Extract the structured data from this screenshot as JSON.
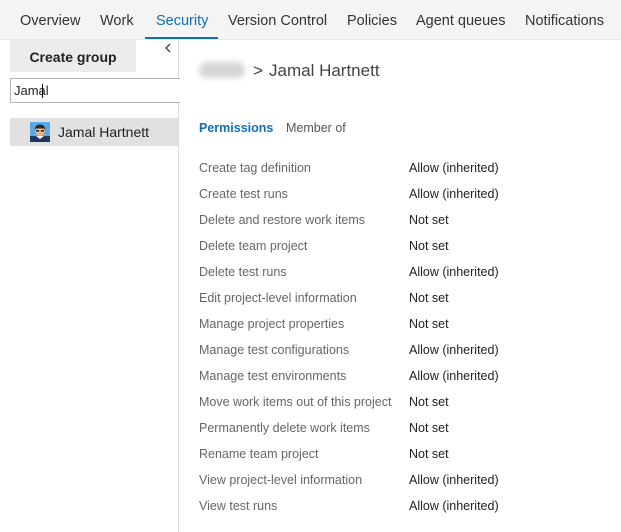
{
  "nav": {
    "tabs": [
      {
        "label": "Overview"
      },
      {
        "label": "Work"
      },
      {
        "label": "Security"
      },
      {
        "label": "Version Control"
      },
      {
        "label": "Policies"
      },
      {
        "label": "Agent queues"
      },
      {
        "label": "Notifications"
      }
    ],
    "active_tab": "Security"
  },
  "sidebar": {
    "create_group_label": "Create group",
    "collapse_icon": "chevron-left-icon",
    "search_value": "Jamal",
    "results": [
      {
        "name": "Jamal Hartnett",
        "icon": "user-avatar-icon"
      }
    ]
  },
  "breadcrumb": {
    "separator": ">",
    "current": "Jamal Hartnett"
  },
  "subtabs": {
    "permissions": "Permissions",
    "member_of": "Member of",
    "active": "Permissions"
  },
  "permissions": [
    {
      "name": "Create tag definition",
      "value": "Allow (inherited)"
    },
    {
      "name": "Create test runs",
      "value": "Allow (inherited)"
    },
    {
      "name": "Delete and restore work items",
      "value": "Not set"
    },
    {
      "name": "Delete team project",
      "value": "Not set"
    },
    {
      "name": "Delete test runs",
      "value": "Allow (inherited)"
    },
    {
      "name": "Edit project-level information",
      "value": "Not set"
    },
    {
      "name": "Manage project properties",
      "value": "Not set"
    },
    {
      "name": "Manage test configurations",
      "value": "Allow (inherited)"
    },
    {
      "name": "Manage test environments",
      "value": "Allow (inherited)"
    },
    {
      "name": "Move work items out of this project",
      "value": "Not set"
    },
    {
      "name": "Permanently delete work items",
      "value": "Not set"
    },
    {
      "name": "Rename team project",
      "value": "Not set"
    },
    {
      "name": "View project-level information",
      "value": "Allow (inherited)"
    },
    {
      "name": "View test runs",
      "value": "Allow (inherited)"
    }
  ],
  "colors": {
    "accent": "#106ebe",
    "nav_background": "#f4f4f4",
    "selected_item_background": "#e1e1e1"
  }
}
